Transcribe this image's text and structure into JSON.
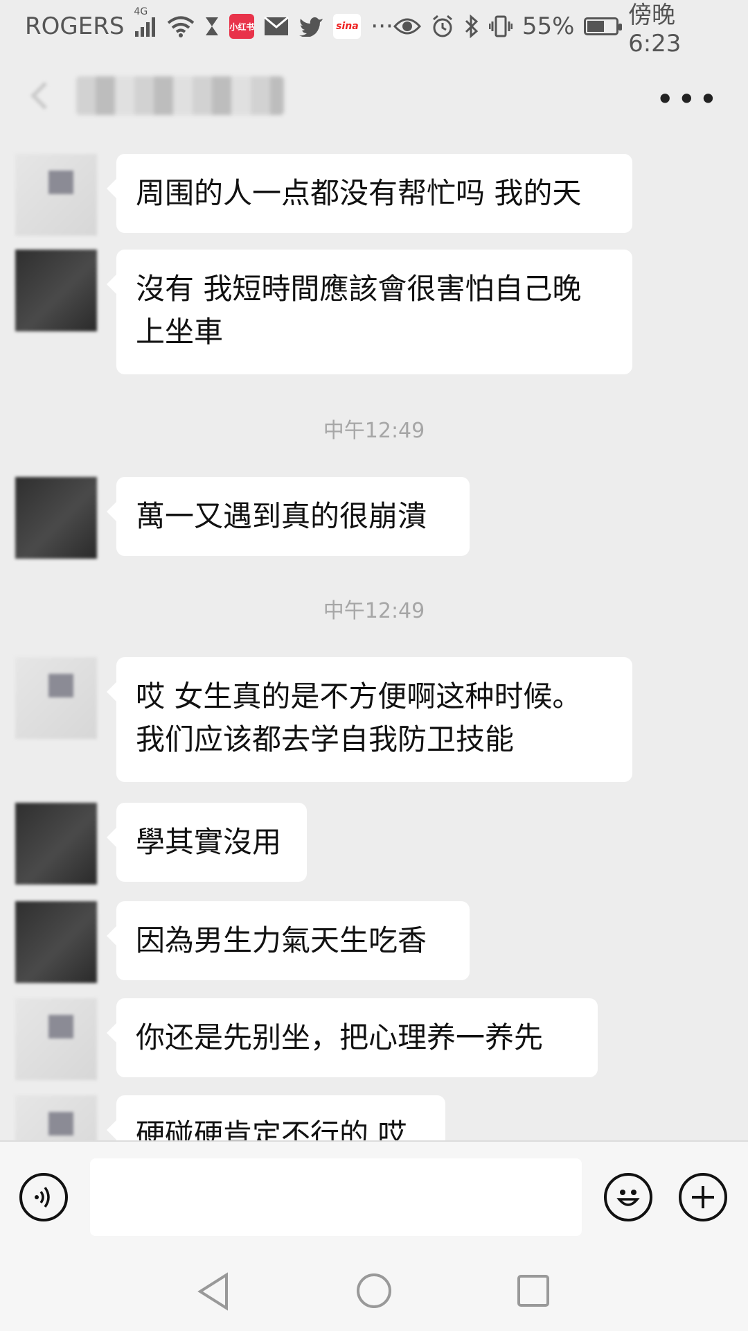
{
  "status_bar": {
    "carrier": "ROGERS",
    "network": "4G",
    "badge_red": "小红书",
    "badge_sina": "sina",
    "more": "···",
    "battery": "55%",
    "battery_level": 0.55,
    "time": "傍晚6:23"
  },
  "header": {
    "more": "•••"
  },
  "messages": [
    {
      "type": "message",
      "avatar": "light",
      "text": "周围的人一点都没有帮忙吗 我的天"
    },
    {
      "type": "message",
      "avatar": "dark",
      "text": "沒有 我短時間應該會很害怕自己晚\n上坐車"
    },
    {
      "type": "time",
      "text": "中午12:49"
    },
    {
      "type": "message",
      "avatar": "dark",
      "text": "萬一又遇到真的很崩潰"
    },
    {
      "type": "time",
      "text": "中午12:49"
    },
    {
      "type": "message",
      "avatar": "light",
      "text": "哎 女生真的是不方便啊这种时候。\n我们应该都去学自我防卫技能"
    },
    {
      "type": "message",
      "avatar": "dark",
      "text": "學其實沒用"
    },
    {
      "type": "message",
      "avatar": "dark",
      "text": "因為男生力氣天生吃香"
    },
    {
      "type": "message",
      "avatar": "light",
      "text": "你还是先别坐，把心理养一养先"
    },
    {
      "type": "message",
      "avatar": "light",
      "text": "硬碰硬肯定不行的 哎"
    }
  ],
  "icons": {
    "voice": "voice-icon",
    "emoji": "emoji-icon",
    "plus": "plus-icon",
    "back_nav": "nav-back-icon",
    "home_nav": "nav-home-icon",
    "recents_nav": "nav-recents-icon"
  }
}
